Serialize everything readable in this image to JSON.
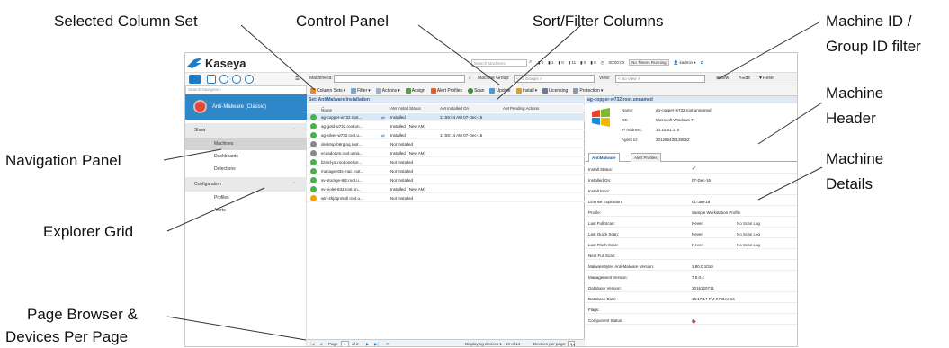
{
  "callouts": {
    "selected_column_set": "Selected Column Set",
    "control_panel": "Control Panel",
    "sort_filter_columns": "Sort/Filter Columns",
    "machine_id_filter_1": "Machine ID /",
    "machine_id_filter_2": "Group ID filter",
    "machine_header_1": "Machine",
    "machine_header_2": "Header",
    "machine_details_1": "Machine",
    "machine_details_2": "Details",
    "navigation_panel": "Navigation Panel",
    "explorer_grid": "Explorer Grid",
    "page_browser_1": "Page Browser &",
    "page_browser_2": "Devices Per Page"
  },
  "app": {
    "logo": "Kaseya",
    "search_placeholder": "Search Machines",
    "top_counts": [
      "0",
      "1",
      "0",
      "11",
      "0",
      "0"
    ],
    "timer": "00:00:00",
    "timer_status": "No Timers Running",
    "user": "kadmin"
  },
  "filter": {
    "machine_id_label": "Machine Id:",
    "machine_group_label": "Machine Group:",
    "machine_group_value": "< All Groups >",
    "view_label": "View:",
    "view_value": "< No View >",
    "new_label": "New",
    "edit_label": "Edit",
    "reset_label": "Reset"
  },
  "nav": {
    "search_placeholder": "Search Navigation",
    "module": "Anti-Malware (Classic)",
    "show_section": "Show",
    "config_section": "Configuration",
    "items_show": [
      "Machines",
      "Dashboards",
      "Detections"
    ],
    "items_config": [
      "Profiles",
      "Alerts"
    ]
  },
  "toolbar": {
    "column_sets": "Column Sets",
    "filter": "Filter",
    "actions": "Actions",
    "assign": "Assign",
    "alert_profiles": "Alert Profiles",
    "scan": "Scan",
    "update": "Update",
    "install": "Install",
    "licensing": "Licensing",
    "protection": "Protection"
  },
  "grid": {
    "title": "Set: AntiMalware Installation",
    "headers": [
      "Name",
      "AM Install Status",
      "AM Installed On",
      "AM Pending Actions"
    ],
    "rows": [
      {
        "name": "ag-copper-w732.root...",
        "status": "Installed",
        "date": "11:59:44 AM 07-Dec-16",
        "color": "#4caf50"
      },
      {
        "name": "ag-gold-w732.root.un...",
        "status": "Installed ( New AM)",
        "date": "",
        "color": "#4caf50"
      },
      {
        "name": "ag-silver-w732.root.u...",
        "status": "Installed",
        "date": "11:59:14 AM 07-Dec-16",
        "color": "#4caf50"
      },
      {
        "name": "desktop-b6rgtoq.root...",
        "status": "Not Installed",
        "date": "",
        "color": "#888888"
      },
      {
        "name": "ecuadorvm.root.unna...",
        "status": "Installed ( New AM)",
        "date": "",
        "color": "#888888"
      },
      {
        "name": "lizard-pc.root.onelice...",
        "status": "Not Installed",
        "date": "",
        "color": "#4caf50"
      },
      {
        "name": "macagent3s-mac.root...",
        "status": "Not Installed",
        "date": "",
        "color": "#4caf50"
      },
      {
        "name": "sv-storage-8r2.root.u...",
        "status": "Not Installed",
        "date": "",
        "color": "#4caf50"
      },
      {
        "name": "sv-violet-832.root.un...",
        "status": "Installed ( New AM)",
        "date": "",
        "color": "#4caf50"
      },
      {
        "name": "win-4hjaqnr5nll.root.u...",
        "status": "Not Installed",
        "date": "",
        "color": "#f0a000"
      }
    ]
  },
  "pager": {
    "page_label": "Page",
    "page_value": "1",
    "of_pages": "of 2",
    "displaying": "Displaying devices 1 - 10 of 14",
    "per_page_label": "Devices per page:",
    "per_page_value": "10"
  },
  "detail": {
    "title": "ag-copper-w732.root.unnamed",
    "header": [
      {
        "label": "Name:",
        "value": "ag-copper-w732.root.unnamed"
      },
      {
        "label": "OS:",
        "value": "Microsoft Windows 7"
      },
      {
        "label": "IP Address:",
        "value": "10.10.51.170"
      },
      {
        "label": "Agent Id:",
        "value": "201266430138052"
      }
    ],
    "tabs": [
      "AntiMalware",
      "Alert Profiles"
    ],
    "rows": [
      {
        "label": "Install Status:",
        "value": "",
        "extra": ""
      },
      {
        "label": "Installed On:",
        "value": "07-Dec-16",
        "extra": ""
      },
      {
        "label": "Install Error:",
        "value": "",
        "extra": ""
      },
      {
        "label": "License Expiration:",
        "value": "01-Jan-18",
        "extra": ""
      },
      {
        "label": "Profile:",
        "value": "Sample Workstation Profile",
        "extra": ""
      },
      {
        "label": "Last Full Scan:",
        "value": "Never",
        "extra": "No Scan Log"
      },
      {
        "label": "Last Quick Scan:",
        "value": "Never",
        "extra": "No Scan Log"
      },
      {
        "label": "Last Flash Scan:",
        "value": "Never",
        "extra": "No Scan Log"
      },
      {
        "label": "Next Full Scan:",
        "value": "",
        "extra": ""
      },
      {
        "label": "MalwareBytes Anti-Malware Version:",
        "value": "1.80.0.1010",
        "extra": ""
      },
      {
        "label": "Management Version:",
        "value": "7.0.0.4",
        "extra": ""
      },
      {
        "label": "Database Version:",
        "value": "2016120711",
        "extra": ""
      },
      {
        "label": "Database Date:",
        "value": "19:17:17 PM 07-Dec-16",
        "extra": ""
      },
      {
        "label": "Flags:",
        "value": "",
        "extra": ""
      },
      {
        "label": "Component Status:",
        "value": "",
        "extra": ""
      }
    ]
  }
}
